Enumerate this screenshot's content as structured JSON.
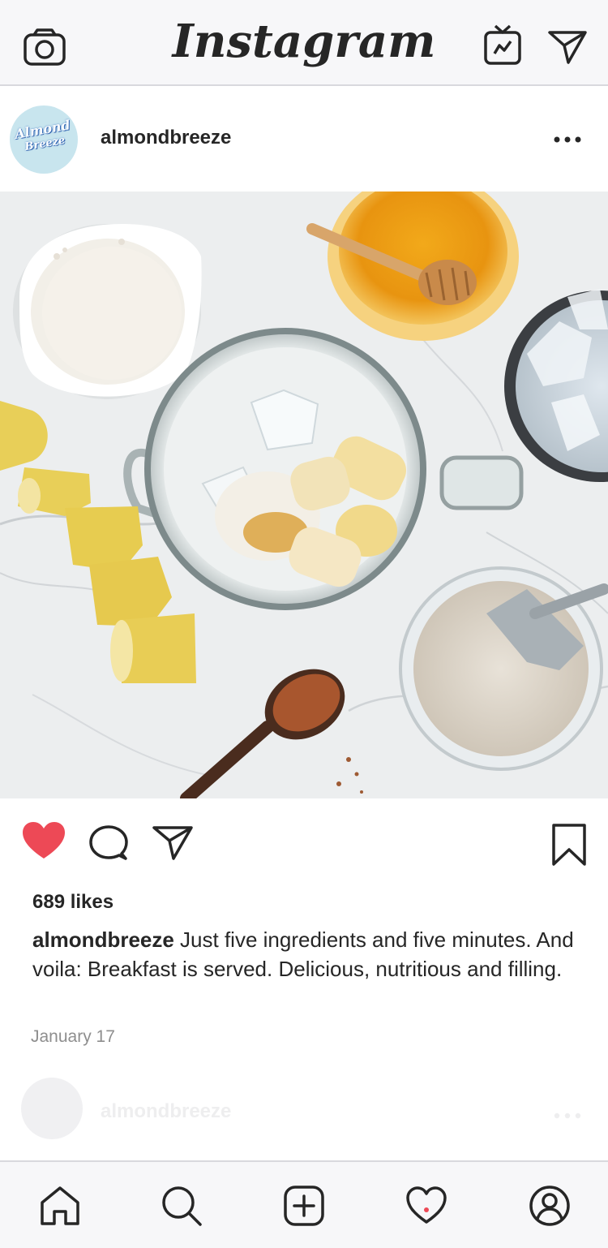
{
  "app": {
    "title": "Instagram"
  },
  "topbar": {
    "camera_icon": "camera-icon",
    "igtv_icon": "igtv-icon",
    "direct_icon": "direct-message-icon"
  },
  "post": {
    "username": "almondbreeze",
    "avatar_logo_line1": "Almond",
    "avatar_logo_line2": "Breeze",
    "avatar_bg": "#c8e5ee",
    "likes": "689 likes",
    "caption_user": "almondbreeze",
    "caption_text": " Just five ingredients and five minutes. And voila: Breakfast is served. Delicious, nutritious and filling.",
    "date": "January 17",
    "liked": true,
    "like_color": "#ed4956"
  },
  "next_post": {
    "username": "almondbreeze"
  },
  "bottom_nav": {
    "items": [
      "home-icon",
      "search-icon",
      "add-post-icon",
      "activity-heart-icon",
      "profile-icon"
    ],
    "notification_dot_color": "#ed4956"
  }
}
